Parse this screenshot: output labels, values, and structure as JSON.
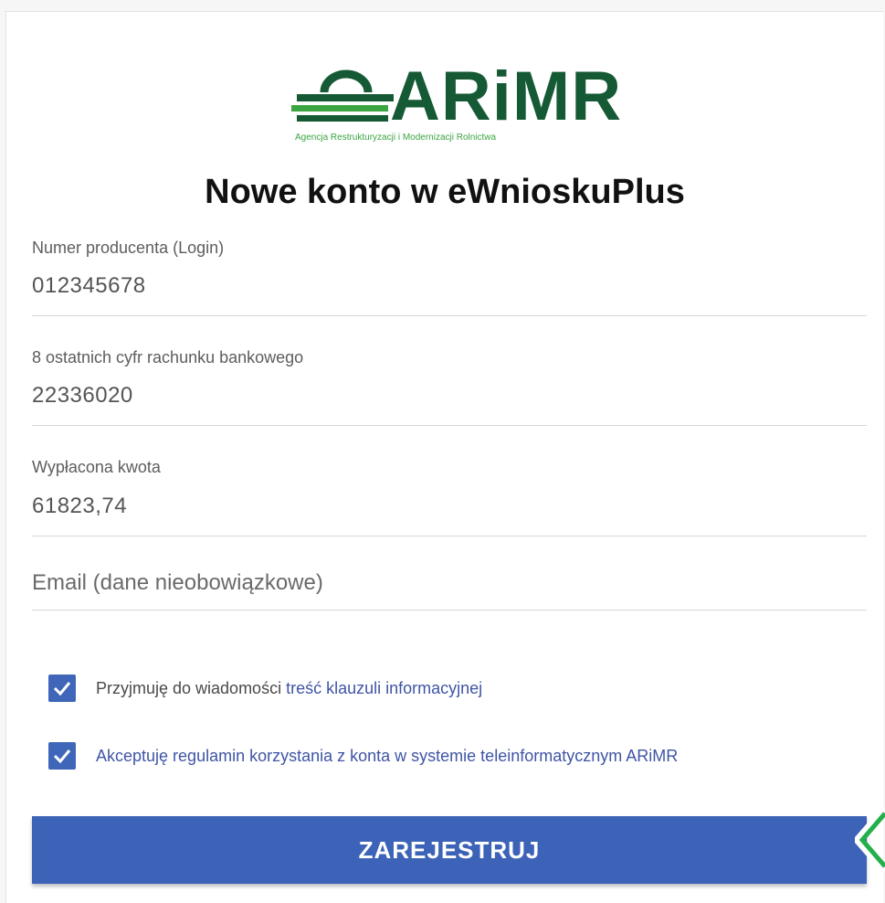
{
  "logo": {
    "name": "ARiMR",
    "subtitle": "Agencja Restrukturyzacji i Modernizacji Rolnictwa"
  },
  "form": {
    "title": "Nowe konto w eWnioskuPlus",
    "fields": [
      {
        "label": "Numer producenta (Login)",
        "value": "012345678"
      },
      {
        "label": "8 ostatnich cyfr rachunku bankowego",
        "value": "22336020"
      },
      {
        "label": "Wypłacona kwota",
        "value": "61823,74"
      }
    ],
    "email_placeholder": "Email (dane nieobowiązkowe)",
    "checkboxes": [
      {
        "checked": true,
        "text": "Przyjmuję do wiadomości ",
        "link": "treść klauzuli informacyjnej"
      },
      {
        "checked": true,
        "text": "Akceptuję regulamin korzystania z konta w systemie teleinformatycznym ARiMR"
      }
    ],
    "submit_label": "ZAREJESTRUJ"
  },
  "colors": {
    "brand_dark_green": "#155a35",
    "brand_light_green": "#3aa541",
    "primary_blue": "#3c63b7",
    "link_blue": "#3f55a6"
  }
}
